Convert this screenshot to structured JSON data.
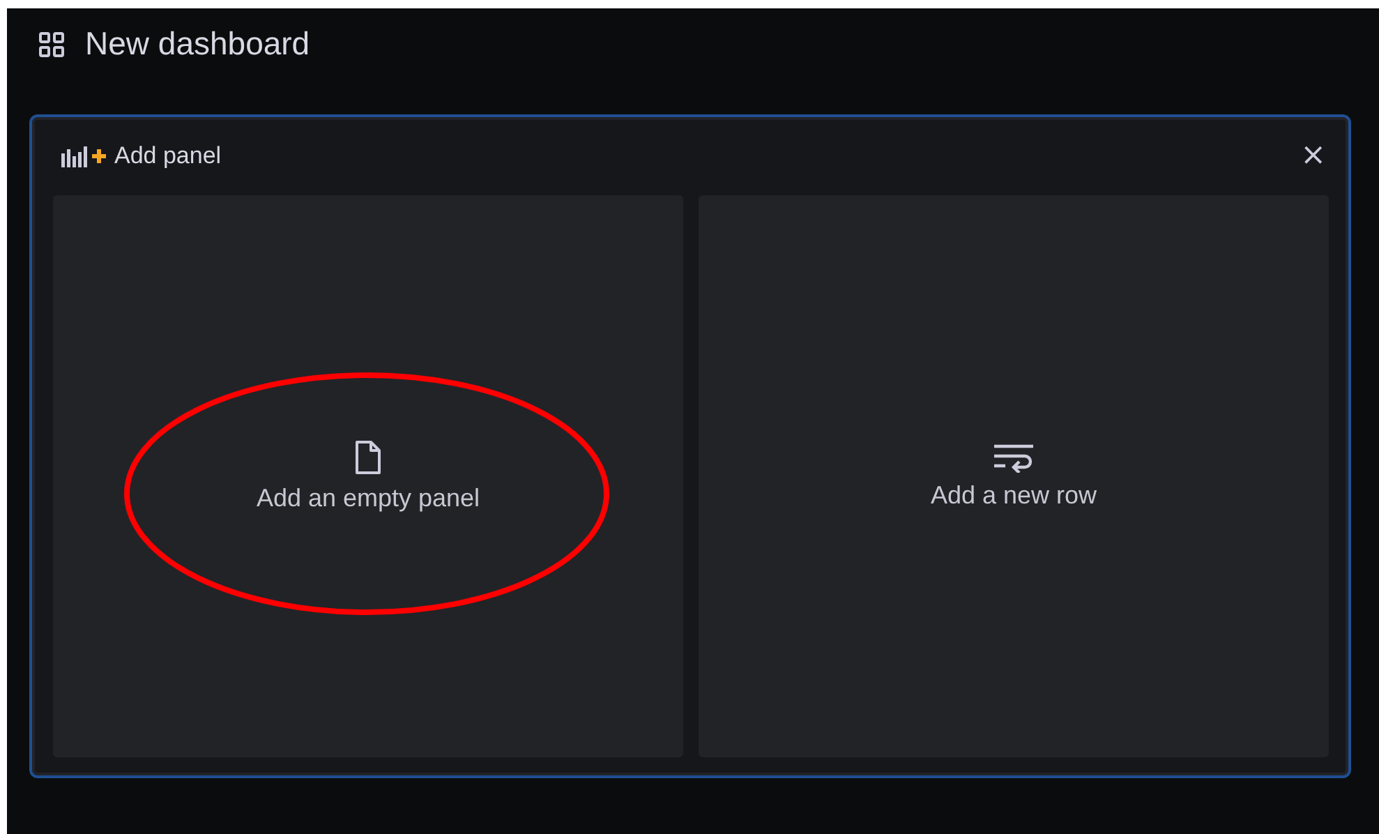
{
  "page": {
    "title": "New dashboard"
  },
  "panel": {
    "title": "Add panel",
    "close": "×",
    "options": [
      {
        "kind": "empty_panel",
        "label": "Add an empty panel",
        "highlighted": true
      },
      {
        "kind": "new_row",
        "label": "Add a new row",
        "highlighted": false
      }
    ]
  }
}
